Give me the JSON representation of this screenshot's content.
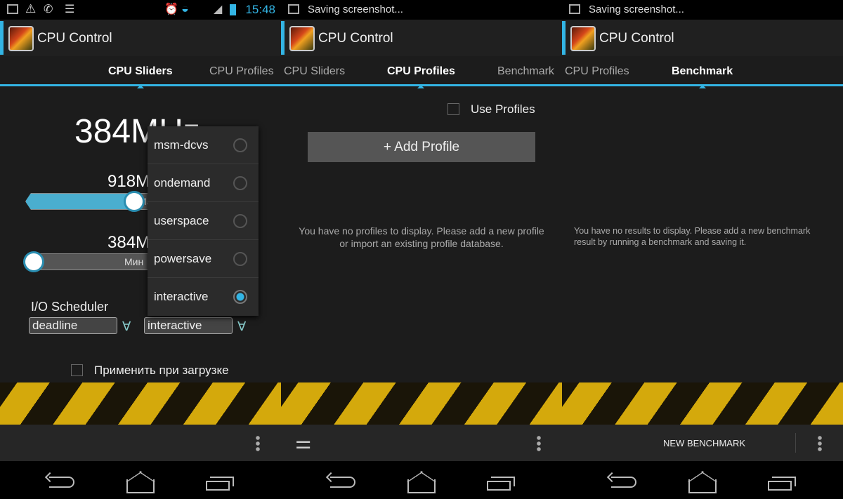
{
  "status": {
    "time": "15:48",
    "saving": "Saving screenshot..."
  },
  "app": {
    "title": "CPU Control"
  },
  "tabs": {
    "sliders": "CPU Sliders",
    "profiles": "CPU Profiles",
    "benchmark": "Benchmark"
  },
  "sliders": {
    "current_freq": "384MHz",
    "max_freq": "918MHz",
    "max_label": "Макс",
    "max_level": 0.65,
    "min_freq": "384MHz",
    "min_label": "Мин",
    "min_level": 0.0,
    "io_scheduler_label": "I/O Scheduler",
    "io_scheduler_value": "deadline",
    "governor_value": "interactive",
    "apply_on_boot": "Применить при загрузке"
  },
  "governor_menu": {
    "options": [
      "msm-dcvs",
      "ondemand",
      "userspace",
      "powersave",
      "interactive"
    ],
    "selected": "interactive"
  },
  "profiles": {
    "use_profiles": "Use Profiles",
    "add_profile": "+ Add Profile",
    "empty": "You have no profiles to display. Please add a new profile or import an existing profile database."
  },
  "benchmark": {
    "empty": "You have no results to display. Please add a new benchmark result by running a benchmark and saving it.",
    "new_benchmark": "NEW BENCHMARK"
  },
  "colors": {
    "accent": "#33b5e5",
    "stripe_yellow": "#d4a90c"
  }
}
